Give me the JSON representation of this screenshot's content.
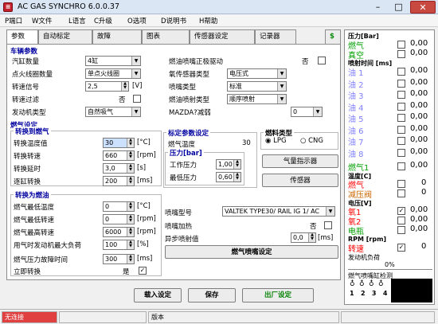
{
  "window": {
    "title": "AC GAS SYNCHRO  6.0.0.37",
    "icon": "app-icon"
  },
  "menu": [
    "P端口",
    "W文件",
    "L语言",
    "C升级",
    "O选项",
    "D说明书",
    "H帮助"
  ],
  "tabs": [
    "参数",
    "自动标定",
    "故障",
    "图表",
    "传感器设定",
    "记录器"
  ],
  "vehicle": {
    "section": "车辆参数",
    "cylinders": {
      "label": "汽缸数量",
      "value": "4缸"
    },
    "ignition": {
      "label": "点火线圈数量",
      "value": "单点火线圈"
    },
    "rpm_signal": {
      "label": "转速信号",
      "value": "2,5",
      "unit": "[V]"
    },
    "rpm_filter": {
      "label": "转速过滤",
      "value": "否"
    },
    "engine_type": {
      "label": "发动机类型",
      "value": "自然吸气"
    },
    "gas_driver": {
      "label": "燃油喷嘴正极驱动",
      "value": "否"
    },
    "o2_type": {
      "label": "氧传感器类型",
      "value": "电压式"
    },
    "inj_type": {
      "label": "喷嘴类型",
      "value": "标准"
    },
    "inj_mode": {
      "label": "燃油喷射类型",
      "value": "顺序喷射"
    },
    "mazda": {
      "label": "MAZDA?减弱",
      "value": "0"
    }
  },
  "fuel": {
    "section": "燃气设定",
    "to_gas": "转换到燃气",
    "temp": {
      "label": "转换温度值",
      "value": "30",
      "unit": "[°C]"
    },
    "rpm": {
      "label": "转换转速",
      "value": "660",
      "unit": "[rpm]"
    },
    "delay": {
      "label": "转换延时",
      "value": "3,0",
      "unit": "[s]"
    },
    "gradual": {
      "label": "逐缸转换",
      "value": "200",
      "unit": "[ms]"
    },
    "to_petrol": "转换为燃油",
    "min_temp": {
      "label": "燃气最低温度",
      "value": "0",
      "unit": "[°C]"
    },
    "min_rpm": {
      "label": "燃气最低转速",
      "value": "0",
      "unit": "[rpm]"
    },
    "max_rpm": {
      "label": "燃气最高转速",
      "value": "6000",
      "unit": "[rpm]"
    },
    "max_load": {
      "label": "用气时发动机最大负荷",
      "value": "100",
      "unit": "[%]"
    },
    "fault_time": {
      "label": "燃气压力故障时间",
      "value": "300",
      "unit": "[ms]"
    },
    "instant": {
      "label": "立即转换",
      "value": "是"
    }
  },
  "calib": {
    "title": "标定参数设定",
    "gas_temp_label": "燃气温度",
    "gas_temp": "30",
    "pressure_title": "压力[bar]",
    "work_label": "工作压力",
    "work": "1,00",
    "min_label": "最低压力",
    "min": "0,60"
  },
  "fueltype": {
    "title": "燃料类型",
    "lpg": "LPG",
    "cng": "CNG",
    "level_btn": "气量指示器",
    "sensor_btn": "传感器"
  },
  "injector": {
    "model_label": "喷嘴型号",
    "model": "VALTEK TYPE30/ RAIL IG 1/ AC",
    "heat_label": "喷嘴加热",
    "heat": "否",
    "async_label": "异步喷射值",
    "async": "0,0",
    "async_unit": "[ms]",
    "set_btn": "燃气喷嘴设定"
  },
  "bottom": {
    "load": "载入设定",
    "save": "保存",
    "factory": "出厂设定"
  },
  "status": {
    "conn": "无连接",
    "version": "版本"
  },
  "right": {
    "pressure_title": "压力[Bar]",
    "gas": "燃气",
    "gas_val": "0,00",
    "vac": "真空",
    "vac_val": "0,00",
    "inj_title": "喷射时间 [ms]",
    "oil": [
      {
        "l": "油 1",
        "v": "0,00"
      },
      {
        "l": "油 2",
        "v": "0,00"
      },
      {
        "l": "油 3",
        "v": "0,00"
      },
      {
        "l": "油 4",
        "v": "0,00"
      },
      {
        "l": "油 5",
        "v": "0,00"
      },
      {
        "l": "油 6",
        "v": "0,00"
      },
      {
        "l": "油 7",
        "v": "0,00"
      },
      {
        "l": "油 8",
        "v": "0,00"
      }
    ],
    "gas1": "燃气1",
    "gas1_val": "0,00",
    "temp_title": "温度[C]",
    "gas_t": "燃气",
    "gas_t_val": "0",
    "red_t": "减压阀",
    "red_t_val": "0",
    "volt_title": "电压[V]",
    "o1": "氧1",
    "o1_val": "0,00",
    "o2": "氧2",
    "o2_val": "0,00",
    "batt": "电瓶",
    "batt_val": "0,00",
    "rpm_title": "RPM [rpm]",
    "rpm_label": "转速",
    "rpm_val": "0",
    "load_title": "发动机负荷",
    "load_val": "0%",
    "inj_check": "燃气喷嘴缸检测",
    "cyl": [
      "1",
      "2",
      "3",
      "4"
    ],
    "colors": {
      "gas": "#00a000",
      "vac": "#00a000",
      "oil": "#8080ff",
      "gas1": "#00a000",
      "o2": "#ff0000",
      "batt": "#00a000",
      "rpm": "#ff0000",
      "temp": "#ff0000",
      "red": "#cc6600"
    }
  }
}
